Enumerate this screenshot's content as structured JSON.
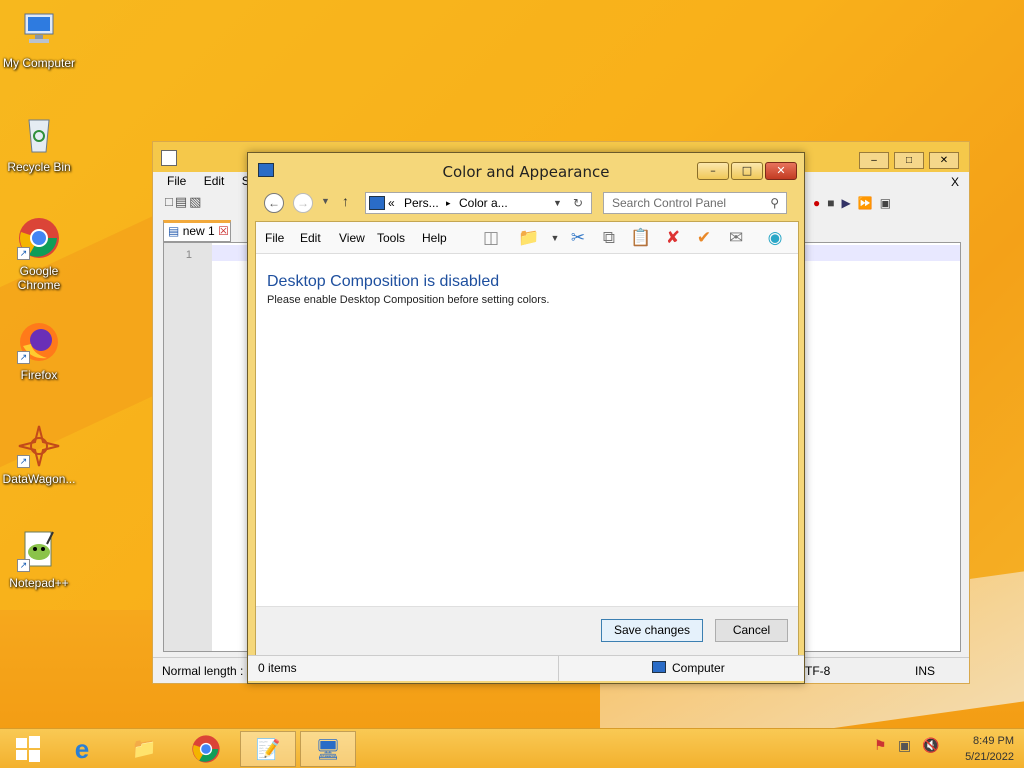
{
  "desktop": {
    "icons": [
      {
        "label": "My Computer",
        "icon": "computer-icon"
      },
      {
        "label": "Recycle Bin",
        "icon": "recycle-bin-icon"
      },
      {
        "label": "Google Chrome",
        "icon": "chrome-icon"
      },
      {
        "label": "Firefox",
        "icon": "firefox-icon"
      },
      {
        "label": "DataWagon...",
        "icon": "datawagon-icon"
      },
      {
        "label": "Notepad++",
        "icon": "notepadpp-icon"
      }
    ]
  },
  "notepadpp": {
    "menu": [
      "File",
      "Edit",
      "Sea"
    ],
    "tab_label": "new 1",
    "line_number": "1",
    "status_left": "Normal length :",
    "status_encoding": "TF-8",
    "status_mode": "INS",
    "close_x": "X"
  },
  "dialog": {
    "title": "Color and Appearance",
    "minimize": "–",
    "maximize": "□",
    "close": "✕",
    "address": {
      "prefix": "«",
      "crumb1": "Pers...",
      "sep": "▸",
      "crumb2": "Color a..."
    },
    "search_placeholder": "Search Control Panel",
    "menu": [
      "File",
      "Edit",
      "View",
      "Tools",
      "Help"
    ],
    "heading": "Desktop Composition is disabled",
    "message": "Please enable Desktop Composition before setting colors.",
    "save_button": "Save changes",
    "cancel_button": "Cancel",
    "status_items": "0 items",
    "status_location": "Computer"
  },
  "taskbar": {
    "time": "8:49 PM",
    "date": "5/21/2022"
  },
  "colors": {
    "accent": "#f5c84a",
    "link_blue": "#1e4f9e",
    "close_red": "#c23b22"
  }
}
